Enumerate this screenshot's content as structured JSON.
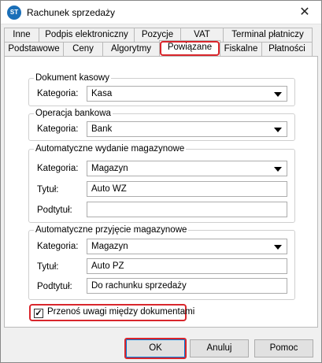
{
  "window": {
    "title": "Rachunek sprzedaży",
    "icon_text": "ST",
    "close_glyph": "✕"
  },
  "tabs": {
    "row1": [
      "Inne",
      "Podpis elektroniczny",
      "Pozycje",
      "VAT",
      "Terminal płatniczy"
    ],
    "row2": [
      "Podstawowe",
      "Ceny",
      "Algorytmy",
      "Powiązane",
      "Fiskalne",
      "Płatności"
    ],
    "active": "Powiązane"
  },
  "groups": {
    "kasowy": {
      "legend": "Dokument kasowy",
      "kategoria_label": "Kategoria:",
      "kategoria_value": "Kasa"
    },
    "bankowa": {
      "legend": "Operacja bankowa",
      "kategoria_label": "Kategoria:",
      "kategoria_value": "Bank"
    },
    "wydanie": {
      "legend": "Automatyczne wydanie magazynowe",
      "kategoria_label": "Kategoria:",
      "kategoria_value": "Magazyn",
      "tytul_label": "Tytuł:",
      "tytul_value": "Auto WZ",
      "podtytul_label": "Podtytuł:",
      "podtytul_value": ""
    },
    "przyjecie": {
      "legend": "Automatyczne przyjęcie magazynowe",
      "kategoria_label": "Kategoria:",
      "kategoria_value": "Magazyn",
      "tytul_label": "Tytuł:",
      "tytul_value": "Auto PZ",
      "podtytul_label": "Podtytuł:",
      "podtytul_value": "Do rachunku sprzedaży"
    }
  },
  "checkbox": {
    "label": "Przenoś uwagi między dokumentami",
    "checked": true,
    "mark": "✓"
  },
  "buttons": {
    "ok": "OK",
    "cancel": "Anuluj",
    "help": "Pomoc"
  },
  "colors": {
    "highlight": "#d9262c",
    "icon_bg": "#1a6fb8",
    "focus_border": "#0078d7"
  }
}
